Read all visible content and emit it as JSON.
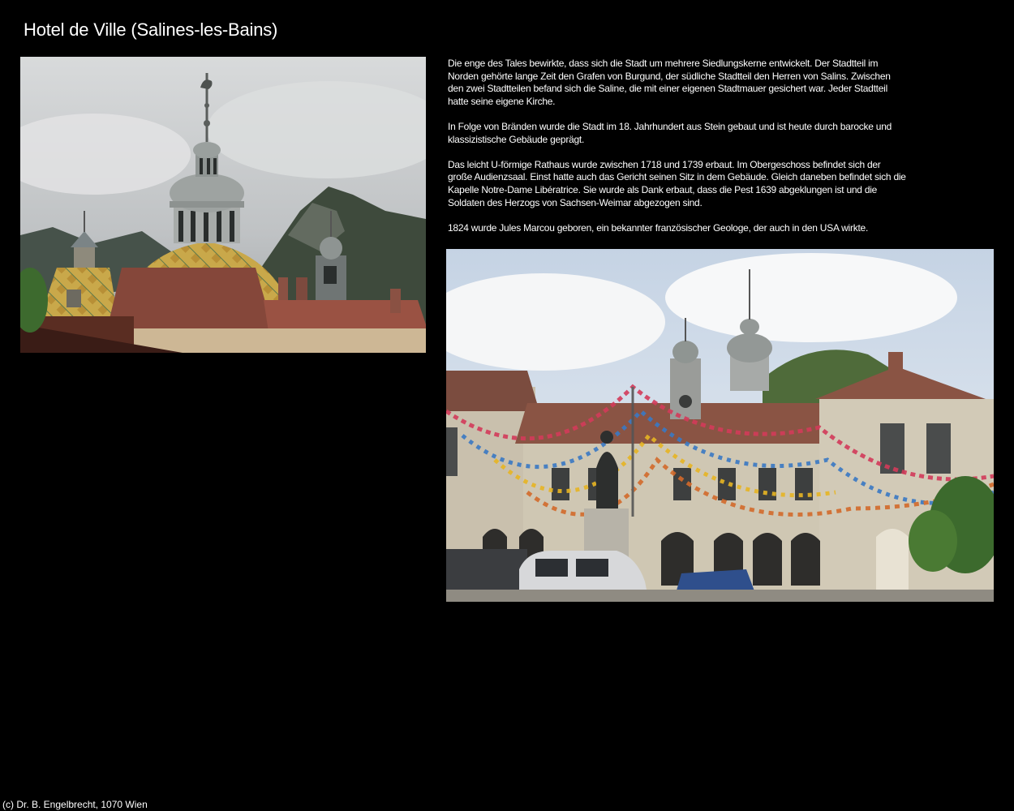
{
  "page": {
    "title": "Hotel de Ville (Salines-les-Bains)",
    "paragraphs": [
      "Die enge des Tales bewirkte, dass sich die Stadt um mehrere Siedlungskerne entwickelt. Der Stadtteil im Norden gehörte lange Zeit den Grafen von Burgund, der südliche Stadtteil den Herren von Salins. Zwischen den zwei Stadtteilen befand sich die Saline, die mit einer eigenen Stadtmauer gesichert war. Jeder Stadtteil hatte seine eigene Kirche.",
      "In Folge von Bränden wurde die Stadt im 18. Jahrhundert aus Stein gebaut und ist heute durch barocke und klassizistische Gebäude geprägt.",
      "Das leicht U-förmige Rathaus wurde zwischen 1718 und 1739 erbaut. Im Obergeschoss befindet sich der große Audienzsaal. Einst hatte auch das Gericht seinen Sitz in dem Gebäude. Gleich daneben befindet sich die Kapelle Notre-Dame Libératrice. Sie wurde als Dank erbaut, dass die Pest 1639 abgeklungen ist und die Soldaten des Herzogs von Sachsen-Weimar abgezogen sind.",
      "1824 wurde Jules Marcou geboren, ein bekannter französischer Geologe, der auch in den USA wirkte."
    ],
    "footer": "(c) Dr. B. Engelbrecht, 1070 Wien"
  },
  "colors": {
    "background": "#000000",
    "text": "#ffffff"
  }
}
